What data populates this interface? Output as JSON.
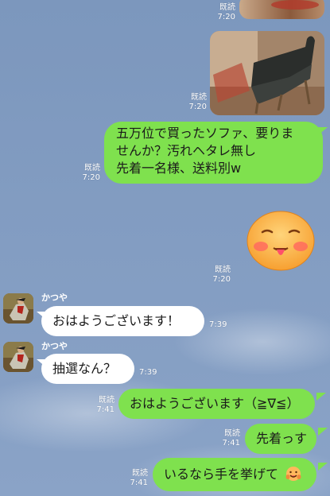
{
  "messages": [
    {
      "read": "既読",
      "time": "7:20"
    },
    {
      "read": "既読",
      "time": "7:20"
    },
    {
      "read": "既読",
      "time": "7:20",
      "lines": [
        "五万位で買ったソファ、要りま",
        "せんか？汚れヘタレ無し",
        "先着一名様、送料別w"
      ]
    },
    {
      "read": "既読",
      "time": "7:20",
      "sticker": "blushing-face-sticker-icon"
    },
    {
      "sender": "かつや",
      "text": "おはようございます！",
      "time": "7:39"
    },
    {
      "sender": "かつや",
      "text": "抽選なん？",
      "time": "7:39"
    },
    {
      "read": "既読",
      "time": "7:41",
      "text": "おはようございます（≧∇≦）"
    },
    {
      "read": "既読",
      "time": "7:41",
      "text": "先着っす"
    },
    {
      "read": "既読",
      "time": "7:41",
      "text": "いるなら手を挙げて",
      "emoji": "hands-raised-face-emoji-icon"
    }
  ],
  "colors": {
    "bubble_green": "#7fe14e",
    "bubble_white": "#ffffff",
    "background": "#7b96bd"
  }
}
